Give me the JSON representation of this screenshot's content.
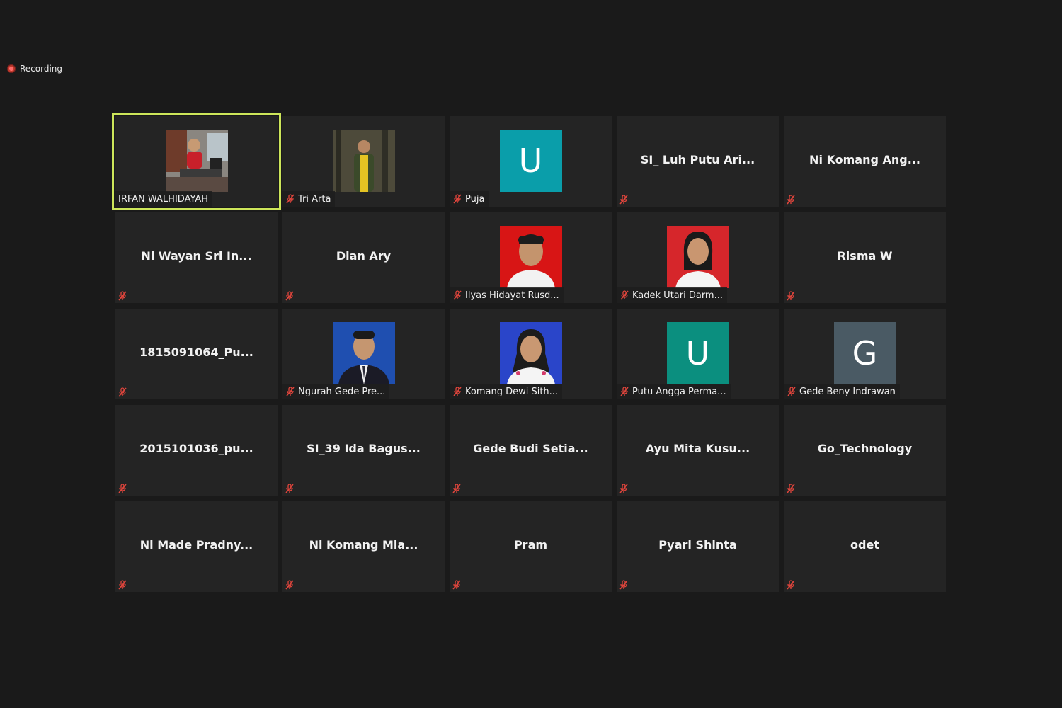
{
  "recording": {
    "label": "Recording",
    "color": "#e02828"
  },
  "active_border_color": "#cde65a",
  "participants": [
    {
      "name": "IRFAN WALHIDAYAH",
      "type": "video",
      "photo": "desk-scene",
      "muted": false,
      "active": true
    },
    {
      "name": "Tri Arta",
      "type": "video",
      "photo": "forest-yellow-shirt",
      "muted": true
    },
    {
      "name": "Puja",
      "type": "avatar",
      "letter": "U",
      "avatar_color": "#0a9eaa",
      "muted": true
    },
    {
      "name": "SI_ Luh Putu Ari...",
      "type": "name",
      "muted": true
    },
    {
      "name": "Ni Komang Ang...",
      "type": "name",
      "muted": true
    },
    {
      "name": "Ni Wayan Sri In...",
      "type": "name",
      "muted": true
    },
    {
      "name": "Dian Ary",
      "type": "name",
      "muted": true
    },
    {
      "name": "Ilyas Hidayat Rusd...",
      "type": "video",
      "photo": "red-bg-portrait",
      "muted": true
    },
    {
      "name": "Kadek Utari Darm...",
      "type": "video",
      "photo": "red-bg-portrait-girl",
      "muted": true
    },
    {
      "name": "Risma W",
      "type": "name",
      "muted": true
    },
    {
      "name": "1815091064_Pu...",
      "type": "name",
      "muted": true
    },
    {
      "name": "Ngurah Gede Pre...",
      "type": "video",
      "photo": "blue-bg-suit",
      "muted": true
    },
    {
      "name": "Komang Dewi Sith...",
      "type": "video",
      "photo": "blue-bg-girl",
      "muted": true
    },
    {
      "name": "Putu Angga Perma...",
      "type": "avatar",
      "letter": "U",
      "avatar_color": "#0b8f7f",
      "muted": true
    },
    {
      "name": "Gede Beny Indrawan",
      "type": "avatar",
      "letter": "G",
      "avatar_color": "#4a5a64",
      "muted": true
    },
    {
      "name": "2015101036_pu...",
      "type": "name",
      "muted": true
    },
    {
      "name": "SI_39 Ida Bagus...",
      "type": "name",
      "muted": true
    },
    {
      "name": "Gede Budi Setia...",
      "type": "name",
      "muted": true
    },
    {
      "name": "Ayu Mita Kusu...",
      "type": "name",
      "muted": true
    },
    {
      "name": "Go_Technology",
      "type": "name",
      "muted": true
    },
    {
      "name": "Ni Made Pradny...",
      "type": "name",
      "muted": true
    },
    {
      "name": "Ni Komang Mia...",
      "type": "name",
      "muted": true
    },
    {
      "name": "Pram",
      "type": "name",
      "muted": true
    },
    {
      "name": "Pyari Shinta",
      "type": "name",
      "muted": true
    },
    {
      "name": "odet",
      "type": "name",
      "muted": true
    }
  ]
}
